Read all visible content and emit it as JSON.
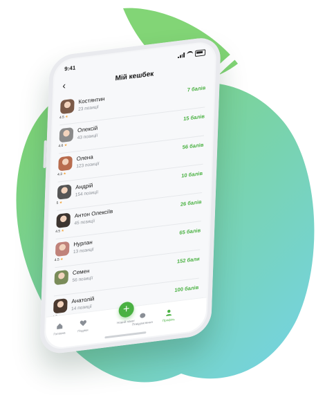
{
  "colors": {
    "accent": "#4ab142",
    "bg_gradient_start": "#7ed36b",
    "bg_gradient_end": "#74d3e8"
  },
  "status_bar": {
    "time": "9:41"
  },
  "header": {
    "title": "Мій кешбек",
    "back_icon": "chevron-left-icon"
  },
  "contacts": [
    {
      "name": "Костянтин",
      "sub": "23 позиції",
      "rating": "4.5",
      "points": "7 балів",
      "avatar_color": "#7b5a48"
    },
    {
      "name": "Олексій",
      "sub": "43 позиції",
      "rating": "4.6",
      "points": "15 балів",
      "avatar_color": "#8a8a8a"
    },
    {
      "name": "Олена",
      "sub": "123 позиції",
      "rating": "4.3",
      "points": "56 балів",
      "avatar_color": "#b86c4e"
    },
    {
      "name": "Андрій",
      "sub": "154 позиції",
      "rating": "5",
      "points": "10 балів",
      "avatar_color": "#555555"
    },
    {
      "name": "Антон Олексіїв",
      "sub": "45 позиції",
      "rating": "4.5",
      "points": "26 балів",
      "avatar_color": "#3d3530"
    },
    {
      "name": "Нурлан",
      "sub": "13 позиції",
      "rating": "4.5",
      "points": "65 балів",
      "avatar_color": "#c0827a"
    },
    {
      "name": "Семен",
      "sub": "56 позиції",
      "rating": "",
      "points": "152 бали",
      "avatar_color": "#7a8c5a"
    },
    {
      "name": "Анатолій",
      "sub": "14 позиції",
      "rating": "4.5",
      "points": "100 балів",
      "avatar_color": "#4b3a30"
    }
  ],
  "tabbar": {
    "items": [
      {
        "label": "Головна",
        "icon": "home-icon"
      },
      {
        "label": "Подяки",
        "icon": "heart-icon"
      },
      {
        "label": "Новий пакет",
        "icon": "plus-icon"
      },
      {
        "label": "Повідомлення",
        "icon": "chat-icon"
      },
      {
        "label": "Профіль",
        "icon": "user-icon"
      }
    ],
    "active_index": 4
  }
}
